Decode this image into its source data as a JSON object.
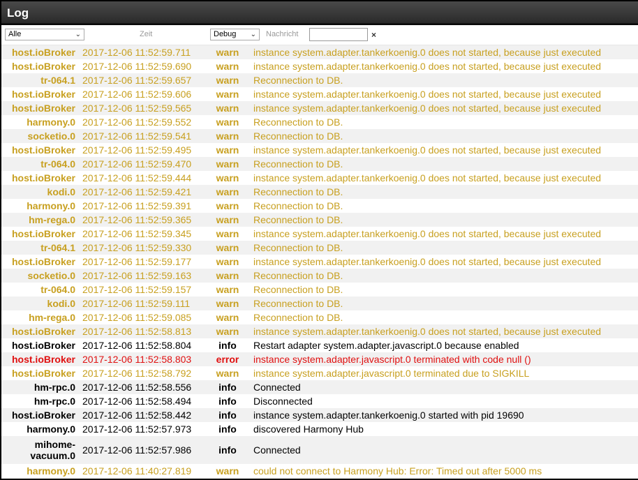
{
  "title": "Log",
  "filters": {
    "source_value": "Alle",
    "time_label": "Zeit",
    "level_value": "Debug",
    "message_label": "Nachricht",
    "search_value": "",
    "clear_symbol": "×"
  },
  "colors": {
    "warn": "#c8a020",
    "info": "#000000",
    "error": "#e01010"
  },
  "rows": [
    {
      "source": "host.ioBroker",
      "time": "2017-12-06 11:52:59.711",
      "level": "warn",
      "message": "instance system.adapter.tankerkoenig.0 does not started, because just executed"
    },
    {
      "source": "host.ioBroker",
      "time": "2017-12-06 11:52:59.690",
      "level": "warn",
      "message": "instance system.adapter.tankerkoenig.0 does not started, because just executed"
    },
    {
      "source": "tr-064.1",
      "time": "2017-12-06 11:52:59.657",
      "level": "warn",
      "message": "Reconnection to DB."
    },
    {
      "source": "host.ioBroker",
      "time": "2017-12-06 11:52:59.606",
      "level": "warn",
      "message": "instance system.adapter.tankerkoenig.0 does not started, because just executed"
    },
    {
      "source": "host.ioBroker",
      "time": "2017-12-06 11:52:59.565",
      "level": "warn",
      "message": "instance system.adapter.tankerkoenig.0 does not started, because just executed"
    },
    {
      "source": "harmony.0",
      "time": "2017-12-06 11:52:59.552",
      "level": "warn",
      "message": "Reconnection to DB."
    },
    {
      "source": "socketio.0",
      "time": "2017-12-06 11:52:59.541",
      "level": "warn",
      "message": "Reconnection to DB."
    },
    {
      "source": "host.ioBroker",
      "time": "2017-12-06 11:52:59.495",
      "level": "warn",
      "message": "instance system.adapter.tankerkoenig.0 does not started, because just executed"
    },
    {
      "source": "tr-064.0",
      "time": "2017-12-06 11:52:59.470",
      "level": "warn",
      "message": "Reconnection to DB."
    },
    {
      "source": "host.ioBroker",
      "time": "2017-12-06 11:52:59.444",
      "level": "warn",
      "message": "instance system.adapter.tankerkoenig.0 does not started, because just executed"
    },
    {
      "source": "kodi.0",
      "time": "2017-12-06 11:52:59.421",
      "level": "warn",
      "message": "Reconnection to DB."
    },
    {
      "source": "harmony.0",
      "time": "2017-12-06 11:52:59.391",
      "level": "warn",
      "message": "Reconnection to DB."
    },
    {
      "source": "hm-rega.0",
      "time": "2017-12-06 11:52:59.365",
      "level": "warn",
      "message": "Reconnection to DB."
    },
    {
      "source": "host.ioBroker",
      "time": "2017-12-06 11:52:59.345",
      "level": "warn",
      "message": "instance system.adapter.tankerkoenig.0 does not started, because just executed"
    },
    {
      "source": "tr-064.1",
      "time": "2017-12-06 11:52:59.330",
      "level": "warn",
      "message": "Reconnection to DB."
    },
    {
      "source": "host.ioBroker",
      "time": "2017-12-06 11:52:59.177",
      "level": "warn",
      "message": "instance system.adapter.tankerkoenig.0 does not started, because just executed"
    },
    {
      "source": "socketio.0",
      "time": "2017-12-06 11:52:59.163",
      "level": "warn",
      "message": "Reconnection to DB."
    },
    {
      "source": "tr-064.0",
      "time": "2017-12-06 11:52:59.157",
      "level": "warn",
      "message": "Reconnection to DB."
    },
    {
      "source": "kodi.0",
      "time": "2017-12-06 11:52:59.111",
      "level": "warn",
      "message": "Reconnection to DB."
    },
    {
      "source": "hm-rega.0",
      "time": "2017-12-06 11:52:59.085",
      "level": "warn",
      "message": "Reconnection to DB."
    },
    {
      "source": "host.ioBroker",
      "time": "2017-12-06 11:52:58.813",
      "level": "warn",
      "message": "instance system.adapter.tankerkoenig.0 does not started, because just executed"
    },
    {
      "source": "host.ioBroker",
      "time": "2017-12-06 11:52:58.804",
      "level": "info",
      "message": "Restart adapter system.adapter.javascript.0 because enabled"
    },
    {
      "source": "host.ioBroker",
      "time": "2017-12-06 11:52:58.803",
      "level": "error",
      "message": "instance system.adapter.javascript.0 terminated with code null ()"
    },
    {
      "source": "host.ioBroker",
      "time": "2017-12-06 11:52:58.792",
      "level": "warn",
      "message": "instance system.adapter.javascript.0 terminated due to SIGKILL"
    },
    {
      "source": "hm-rpc.0",
      "time": "2017-12-06 11:52:58.556",
      "level": "info",
      "message": "Connected"
    },
    {
      "source": "hm-rpc.0",
      "time": "2017-12-06 11:52:58.494",
      "level": "info",
      "message": "Disconnected"
    },
    {
      "source": "host.ioBroker",
      "time": "2017-12-06 11:52:58.442",
      "level": "info",
      "message": "instance system.adapter.tankerkoenig.0 started with pid 19690"
    },
    {
      "source": "harmony.0",
      "time": "2017-12-06 11:52:57.973",
      "level": "info",
      "message": "discovered Harmony Hub"
    },
    {
      "source": "mihome-vacuum.0",
      "time": "2017-12-06 11:52:57.986",
      "level": "info",
      "message": "Connected",
      "tall": true
    },
    {
      "source": "harmony.0",
      "time": "2017-12-06 11:40:27.819",
      "level": "warn",
      "message": "could not connect to Harmony Hub: Error: Timed out after 5000 ms"
    }
  ]
}
